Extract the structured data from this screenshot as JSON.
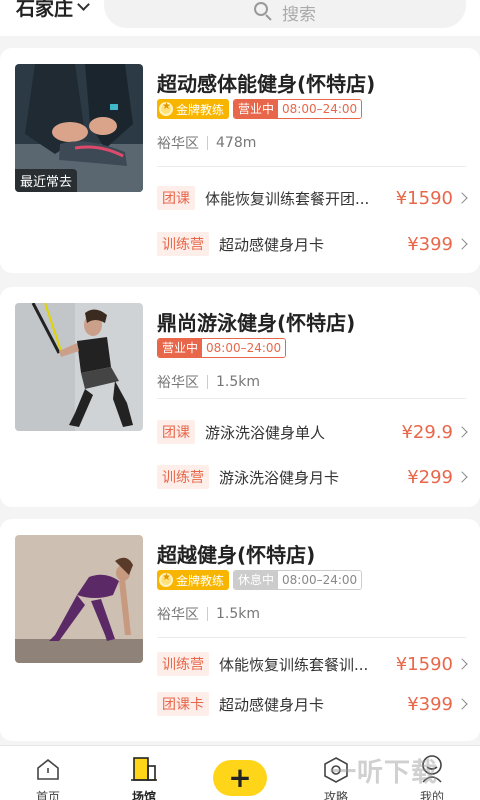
{
  "header": {
    "city": "石家庄",
    "search_placeholder": "搜索"
  },
  "gyms": [
    {
      "name": "超动感体能健身(怀特店)",
      "thumb_badge": "最近常去",
      "coach_tag": "金牌教练",
      "status": "营业中",
      "hours": "08:00–24:00",
      "district": "裕华区",
      "distance": "478m",
      "products": [
        {
          "tag": "团课",
          "name": "体能恢复训练套餐开团...",
          "price": "¥1590"
        },
        {
          "tag": "训练营",
          "name": "超动感健身月卡",
          "price": "¥399"
        }
      ]
    },
    {
      "name": "鼎尚游泳健身(怀特店)",
      "status": "营业中",
      "hours": "08:00–24:00",
      "district": "裕华区",
      "distance": "1.5km",
      "products": [
        {
          "tag": "团课",
          "name": "游泳洗浴健身单人",
          "price": "¥29.9"
        },
        {
          "tag": "训练营",
          "name": "游泳洗浴健身月卡",
          "price": "¥299"
        }
      ]
    },
    {
      "name": "超越健身(怀特店)",
      "coach_tag": "金牌教练",
      "status": "休息中",
      "hours": "08:00–24:00",
      "district": "裕华区",
      "distance": "1.5km",
      "products": [
        {
          "tag": "训练营",
          "name": "体能恢复训练套餐训...",
          "price": "¥1590"
        },
        {
          "tag": "团课卡",
          "name": "超动感健身月卡",
          "price": "¥399"
        }
      ]
    }
  ],
  "nav": [
    {
      "label": "首页",
      "icon": "home-icon"
    },
    {
      "label": "场馆",
      "icon": "venue-icon",
      "active": true
    },
    {
      "label": "",
      "icon": "plus-icon"
    },
    {
      "label": "攻略",
      "icon": "guide-icon"
    },
    {
      "label": "我的",
      "icon": "profile-icon"
    }
  ],
  "watermark": "一听下载",
  "colors": {
    "accent": "#e8674a",
    "gold": "#f7b500",
    "plus": "#ffd51a"
  }
}
